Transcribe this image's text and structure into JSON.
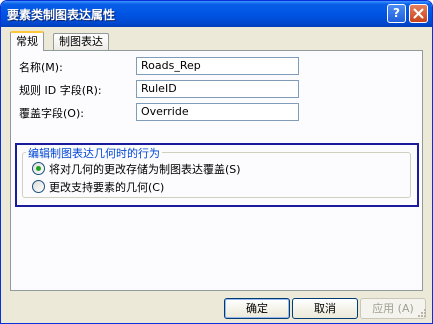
{
  "window": {
    "title": "要素类制图表达属性",
    "help_glyph": "?"
  },
  "tabs": [
    {
      "label": "常规",
      "active": true
    },
    {
      "label": "制图表达",
      "active": false
    }
  ],
  "fields": [
    {
      "label": "名称(M):",
      "value": "Roads_Rep"
    },
    {
      "label": "规则 ID 字段(R):",
      "value": "RuleID"
    },
    {
      "label": "覆盖字段(O):",
      "value": "Override"
    }
  ],
  "group": {
    "title": "编辑制图表达几何时的行为",
    "options": [
      {
        "label": "将对几何的更改存储为制图表达覆盖(S)",
        "selected": true
      },
      {
        "label": "更改支持要素的几何(C)",
        "selected": false
      }
    ]
  },
  "buttons": {
    "ok": "确定",
    "cancel": "取消",
    "apply": "应用 (A)"
  },
  "colors": {
    "title_bar": "#0054e3",
    "highlight_box": "#1b1b9e",
    "group_title": "#0046d5",
    "radio_selected": "#21a121"
  }
}
